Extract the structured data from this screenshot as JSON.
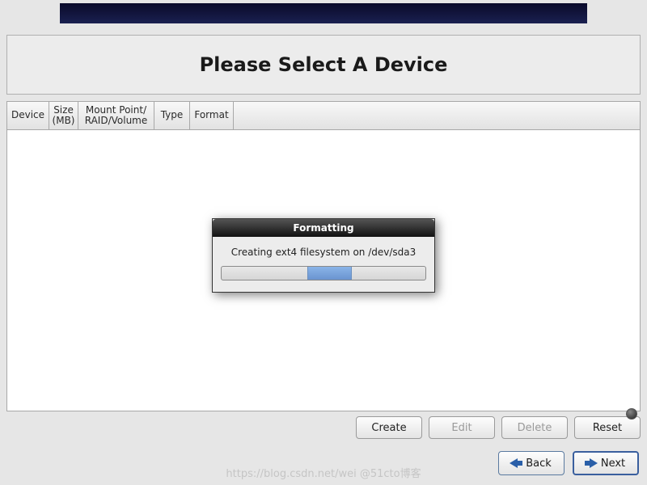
{
  "banner": {
    "color": "#1a2050"
  },
  "header": {
    "title": "Please Select A Device"
  },
  "table": {
    "columns": {
      "device": "Device",
      "size_line1": "Size",
      "size_line2": "(MB)",
      "mount_line1": "Mount Point/",
      "mount_line2": "RAID/Volume",
      "type": "Type",
      "format": "Format"
    }
  },
  "actions": {
    "create": "Create",
    "edit": "Edit",
    "delete": "Delete",
    "reset": "Reset"
  },
  "nav": {
    "back": "Back",
    "next": "Next"
  },
  "modal": {
    "title": "Formatting",
    "message": "Creating ext4 filesystem on /dev/sda3",
    "progress_left_pct": 42,
    "progress_width_pct": 22
  },
  "watermark": "https://blog.csdn.net/wei @51cto博客"
}
